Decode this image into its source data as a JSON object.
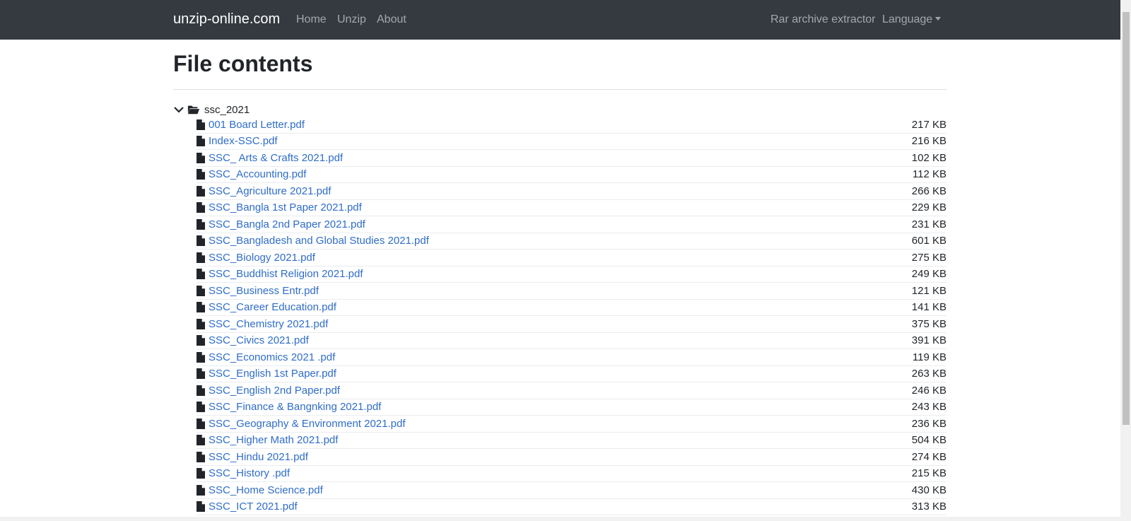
{
  "navbar": {
    "brand": "unzip-online.com",
    "links": [
      "Home",
      "Unzip",
      "About"
    ],
    "right_links": [
      "Rar archive extractor"
    ],
    "language": "Language"
  },
  "page": {
    "title": "File contents"
  },
  "folder": {
    "name": "ssc_2021"
  },
  "files": [
    {
      "name": "001 Board Letter.pdf",
      "size": "217 KB"
    },
    {
      "name": "Index-SSC.pdf",
      "size": "216 KB"
    },
    {
      "name": "SSC_ Arts & Crafts 2021.pdf",
      "size": "102 KB"
    },
    {
      "name": "SSC_Accounting.pdf",
      "size": "112 KB"
    },
    {
      "name": "SSC_Agriculture 2021.pdf",
      "size": "266 KB"
    },
    {
      "name": "SSC_Bangla 1st Paper 2021.pdf",
      "size": "229 KB"
    },
    {
      "name": "SSC_Bangla 2nd Paper 2021.pdf",
      "size": "231 KB"
    },
    {
      "name": "SSC_Bangladesh and Global Studies 2021.pdf",
      "size": "601 KB"
    },
    {
      "name": "SSC_Biology 2021.pdf",
      "size": "275 KB"
    },
    {
      "name": "SSC_Buddhist Religion 2021.pdf",
      "size": "249 KB"
    },
    {
      "name": "SSC_Business Entr.pdf",
      "size": "121 KB"
    },
    {
      "name": "SSC_Career Education.pdf",
      "size": "141 KB"
    },
    {
      "name": "SSC_Chemistry 2021.pdf",
      "size": "375 KB"
    },
    {
      "name": "SSC_Civics 2021.pdf",
      "size": "391 KB"
    },
    {
      "name": "SSC_Economics 2021 .pdf",
      "size": "119 KB"
    },
    {
      "name": "SSC_English 1st Paper.pdf",
      "size": "263 KB"
    },
    {
      "name": "SSC_English 2nd Paper.pdf",
      "size": "246 KB"
    },
    {
      "name": "SSC_Finance & Bangnking 2021.pdf",
      "size": "243 KB"
    },
    {
      "name": "SSC_Geography & Environment 2021.pdf",
      "size": "236 KB"
    },
    {
      "name": "SSC_Higher Math 2021.pdf",
      "size": "504 KB"
    },
    {
      "name": "SSC_Hindu 2021.pdf",
      "size": "274 KB"
    },
    {
      "name": "SSC_History .pdf",
      "size": "215 KB"
    },
    {
      "name": "SSC_Home Science.pdf",
      "size": "430 KB"
    },
    {
      "name": "SSC_ICT 2021.pdf",
      "size": "313 KB"
    }
  ],
  "icons": {
    "folder_toggle": "chevron-down-icon",
    "folder": "folder-open-icon",
    "file": "file-icon"
  },
  "colors": {
    "navbar_bg": "#343a40",
    "link": "#2f6dc9",
    "text": "#212529"
  }
}
